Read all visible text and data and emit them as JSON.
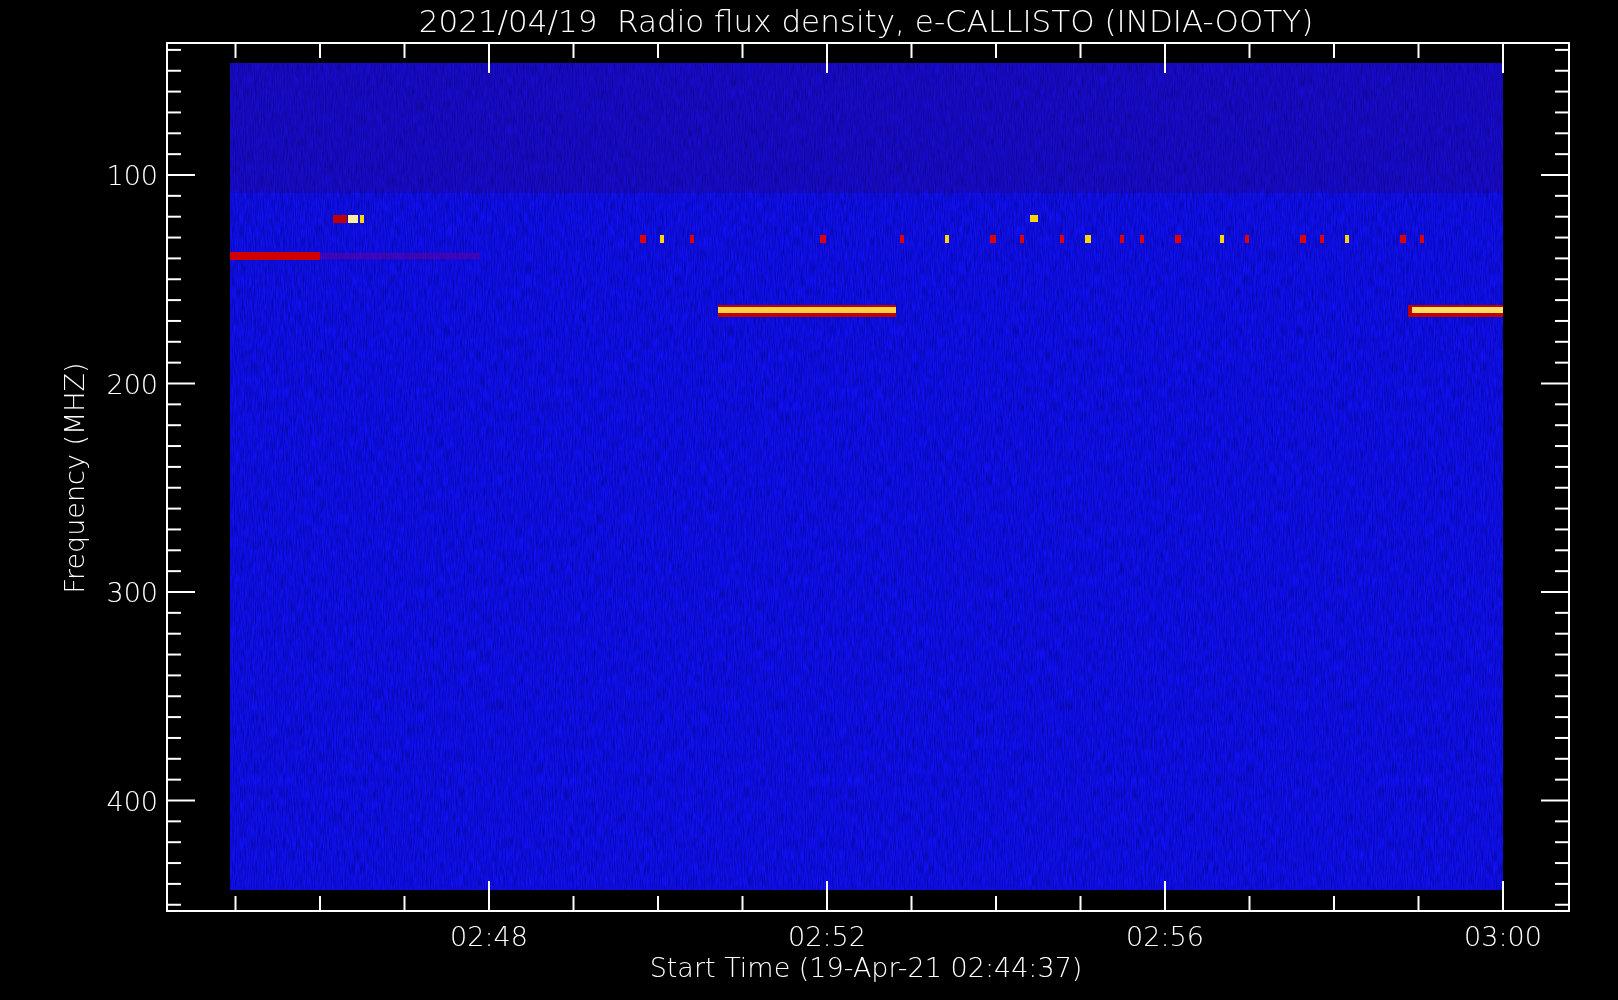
{
  "title": "2021/04/19  Radio flux density, e-CALLISTO (INDIA-OOTY)",
  "x_axis": {
    "label": "Start Time (19-Apr-21 02:44:37)",
    "ticks": [
      "02:48",
      "02:52",
      "02:56",
      "03:00"
    ]
  },
  "y_axis": {
    "label": "Frequency (MHZ)",
    "ticks": [
      "100",
      "200",
      "300",
      "400"
    ]
  }
}
